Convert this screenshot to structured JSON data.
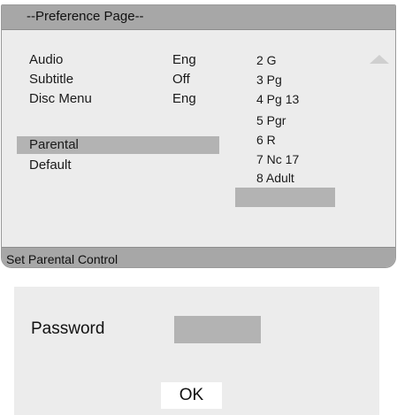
{
  "menu": {
    "title": "--Preference Page--",
    "items": [
      {
        "label": "Audio",
        "value": "Eng"
      },
      {
        "label": "Subtitle",
        "value": "Off"
      },
      {
        "label": "Disc Menu",
        "value": "Eng"
      },
      {
        "label": "Parental",
        "value": ""
      },
      {
        "label": "Default",
        "value": ""
      }
    ],
    "selected_item": "Parental",
    "ratings": [
      "2 G",
      "3 Pg",
      "4 Pg 13",
      "5 Pgr",
      "6 R",
      "7 Nc 17",
      "8 Adult"
    ],
    "selected_rating": "8 Adult",
    "scroll_icon": "up-triangle-icon",
    "status": "Set Parental Control"
  },
  "password_dialog": {
    "label": "Password",
    "input_value": "",
    "ok_label": "OK"
  },
  "colors": {
    "bar": "#a7a7a7",
    "panel": "#ececec",
    "highlight": "#b3b3b3"
  }
}
